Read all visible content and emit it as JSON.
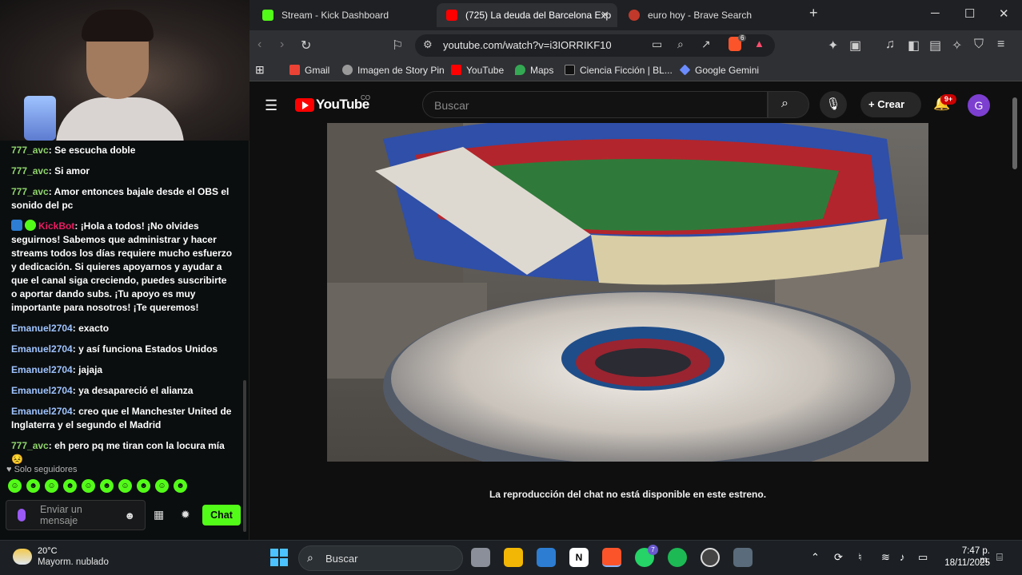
{
  "browser": {
    "tabs": [
      {
        "title": "Stream - Kick Dashboard",
        "icon": "kick-icon"
      },
      {
        "title": "(725) La deuda del Barcelona Exp",
        "icon": "youtube-icon",
        "active": true
      },
      {
        "title": "euro hoy - Brave Search",
        "icon": "brave-search-icon"
      }
    ],
    "url": "youtube.com/watch?v=i3IORRIKF10",
    "brave_shield_count": "6",
    "bookmarks": [
      "Gmail",
      "Imagen de Story Pin",
      "YouTube",
      "Maps",
      "Ciencia Ficción | BL...",
      "Google Gemini"
    ]
  },
  "youtube": {
    "logo": "YouTube",
    "country": "CO",
    "search_placeholder": "Buscar",
    "create_label": "Crear",
    "notifications": "9+",
    "avatar_letter": "G",
    "premiere_message": "La reproducción del chat no está disponible en este estreno."
  },
  "chat": {
    "messages": [
      {
        "user": "777_avc",
        "text": "Se escucha doble",
        "color": "green"
      },
      {
        "user": "777_avc",
        "text": "Si amor",
        "color": "green"
      },
      {
        "user": "777_avc",
        "text": "Amor entonces bajale desde el OBS el sonido del pc",
        "color": "green"
      },
      {
        "user": "KickBot",
        "text": "¡Hola a todos! ¡No olvides seguirnos! Sabemos que administrar y hacer streams todos los días requiere mucho esfuerzo y dedicación. Si quieres apoyarnos y ayudar a que el canal siga creciendo, puedes suscribirte o aportar dando subs. ¡Tu apoyo es muy importante para nosotros! ¡Te queremos!",
        "color": "bot"
      },
      {
        "user": "Emanuel2704",
        "text": "exacto",
        "color": "blue"
      },
      {
        "user": "Emanuel2704",
        "text": "y así funciona Estados Unidos",
        "color": "blue"
      },
      {
        "user": "Emanuel2704",
        "text": "jajaja",
        "color": "blue"
      },
      {
        "user": "Emanuel2704",
        "text": "ya desapareció el alianza",
        "color": "blue"
      },
      {
        "user": "Emanuel2704",
        "text": "creo que el Manchester United de Inglaterra y el segundo el Madrid",
        "color": "blue"
      },
      {
        "user": "777_avc",
        "text": "eh pero pq me tiran con la locura mía 😣",
        "color": "green"
      }
    ],
    "follow_only": "Solo seguidores",
    "input_placeholder": "Enviar un mensaje",
    "send_label": "Chat"
  },
  "taskbar": {
    "temperature": "20°C",
    "weather": "Mayorm. nublado",
    "search_label": "Buscar",
    "whatsapp_badge": "7",
    "time": "7:47 p. m.",
    "date": "18/11/2025"
  },
  "colors": {
    "kick_green": "#53fc18",
    "youtube_red": "#ff0000",
    "bot_pink": "#e91e63"
  }
}
